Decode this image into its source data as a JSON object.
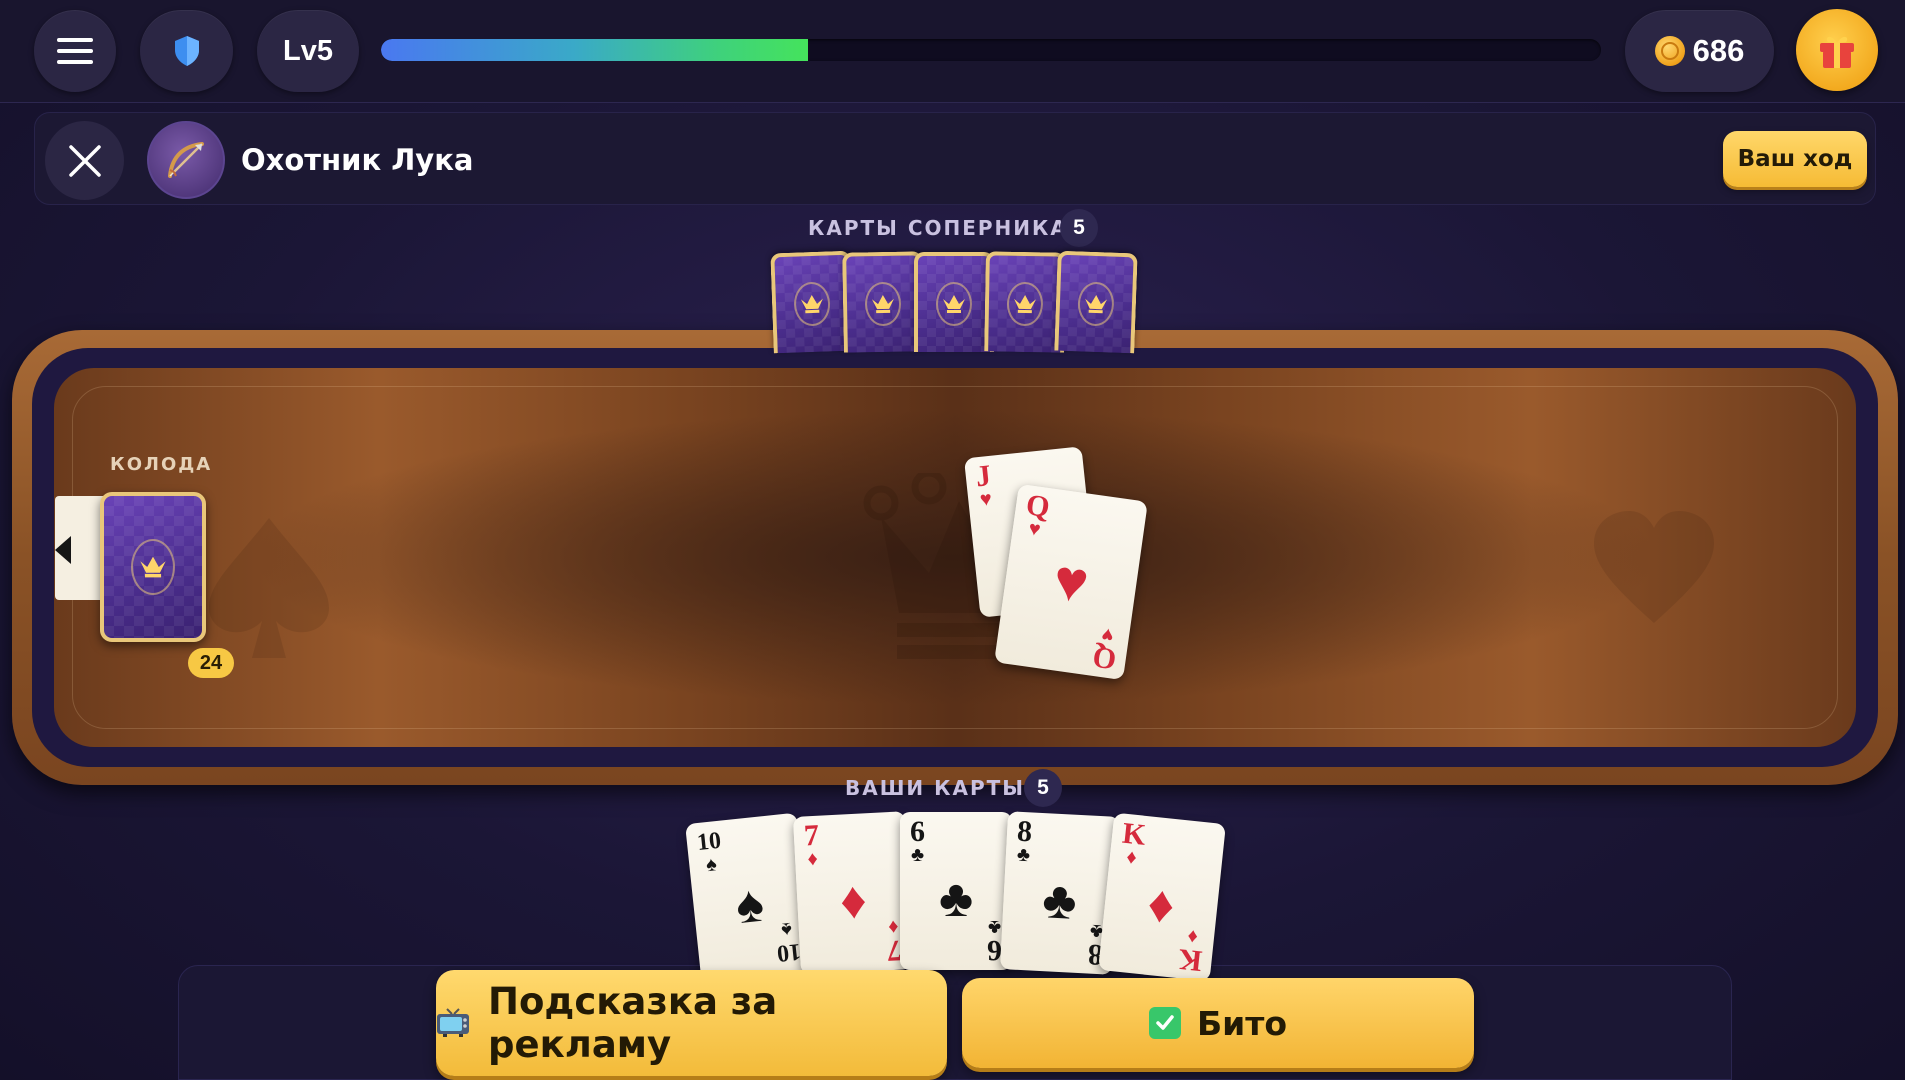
{
  "topbar": {
    "level": "Lv5",
    "xp_progress": 0.35,
    "coins": "686"
  },
  "opponent": {
    "name": "Охотник Лука",
    "turn_label": "Ваш ход"
  },
  "opponent_cards": {
    "label": "КАРТЫ СОПЕРНИКА",
    "count": "5"
  },
  "deck": {
    "label": "КОЛОДА",
    "count": "24"
  },
  "table": {
    "cards": [
      {
        "rank": "J",
        "suit": "♥",
        "color": "red"
      },
      {
        "rank": "Q",
        "suit": "♥",
        "color": "red"
      }
    ]
  },
  "hand": {
    "label": "ВАШИ КАРТЫ",
    "count": "5",
    "cards": [
      {
        "rank": "10",
        "suit": "♠",
        "color": "black"
      },
      {
        "rank": "7",
        "suit": "♦",
        "color": "red"
      },
      {
        "rank": "6",
        "suit": "♣",
        "color": "black"
      },
      {
        "rank": "8",
        "suit": "♣",
        "color": "black"
      },
      {
        "rank": "K",
        "suit": "♦",
        "color": "red"
      }
    ]
  },
  "actions": {
    "hint_label": "Подсказка за рекламу",
    "bito_label": "Бито"
  },
  "colors": {
    "accent_gold": "#f6bb35",
    "xp_green": "#45e35c",
    "card_back": "#4a2d8c"
  }
}
